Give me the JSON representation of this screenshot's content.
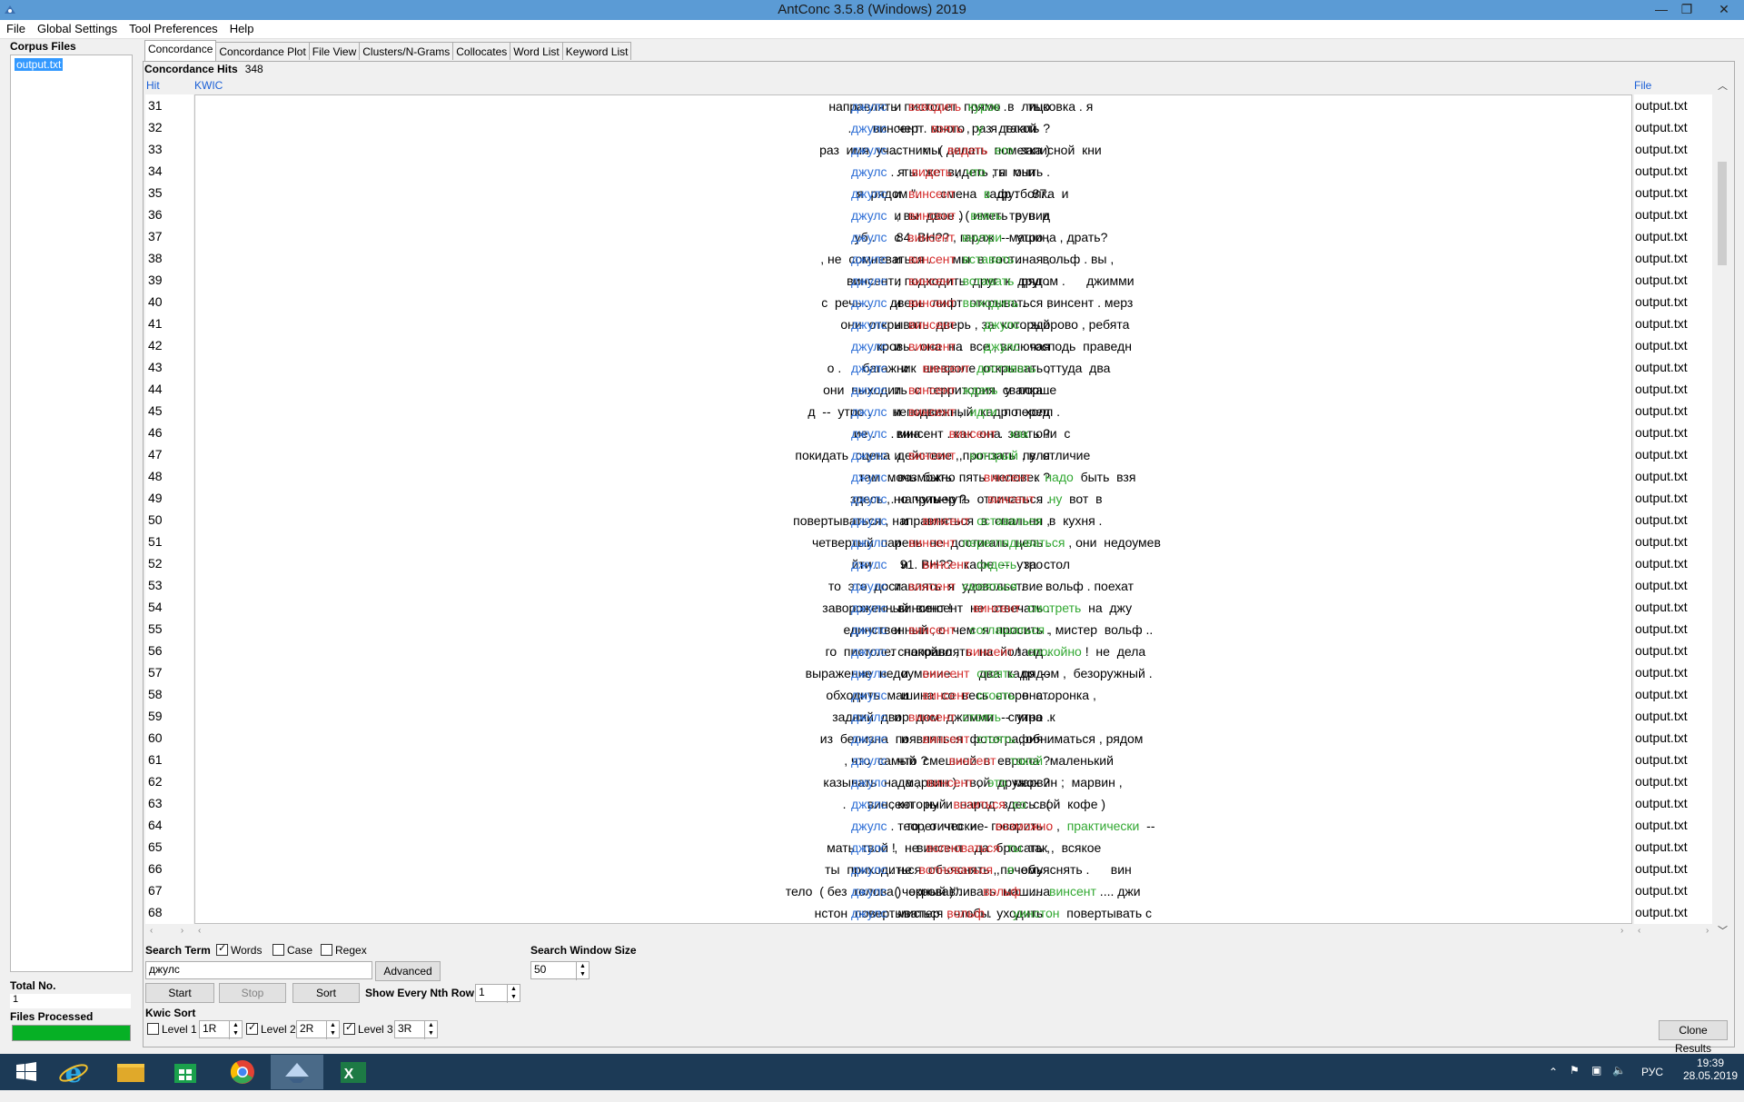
{
  "window": {
    "title": "AntConc 3.5.8 (Windows) 2019"
  },
  "menu": [
    "File",
    "Global Settings",
    "Tool Preferences",
    "Help"
  ],
  "corpus": {
    "title": "Corpus Files",
    "files": [
      "output.txt"
    ],
    "total_label": "Total No.",
    "total_value": "1",
    "processed_label": "Files Processed",
    "processed_fraction": 1.0
  },
  "tabs": [
    "Concordance",
    "Concordance Plot",
    "File View",
    "Clusters/N-Grams",
    "Collocates",
    "Word List",
    "Keyword List"
  ],
  "concordance": {
    "hits_label": "Concordance Hits",
    "hits_value": "348",
    "col_hit": "Hit",
    "col_kwic": "KWIC",
    "col_file": "File",
    "rows": [
      {
        "n": "31",
        "left": "направлять  пистолет  прямо  в  лицо",
        "kw": "джулс",
        "right": [
          [
            "  и  ",
            ""
          ],
          [
            "взводить",
            "r"
          ],
          [
            "  курок",
            "g"
          ],
          [
            " .      тыковка . я",
            ""
          ]
        ]
      },
      {
        "n": "32",
        "left": ".      винсент . много  раз  делать ?",
        "kw": "джулс",
        "right": [
          [
            " . черт  ",
            ""
          ],
          [
            "взять",
            "r"
          ],
          [
            " ,  ",
            ""
          ],
          [
            "у",
            "g"
          ],
          [
            "  я  такой",
            ""
          ]
        ]
      },
      {
        "n": "33",
        "left": "раз  имя  участник . ( делать  пометка )",
        "kw": "джулс",
        "right": [
          [
            " ...      мы  ",
            ""
          ],
          [
            "видеть",
            "r"
          ],
          [
            "  его",
            "g"
          ],
          [
            "  записной  кни",
            ""
          ]
        ]
      },
      {
        "n": "34",
        "left": ". ты  же  видеть , я  мыть .",
        "kw": "джулс",
        "right": [
          [
            " . я  ",
            ""
          ],
          [
            "видеть",
            "r"
          ],
          [
            " ,  ",
            ""
          ],
          [
            "что",
            "g"
          ],
          [
            "  ты  они",
            ""
          ]
        ]
      },
      {
        "n": "35",
        "left": "я  рядом \".      смена  кадр :    87.",
        "kw": "джулс",
        "right": [
          [
            "  и  ",
            ""
          ],
          [
            "винсент",
            "r"
          ],
          [
            " .      ",
            ""
          ],
          [
            "в",
            "g"
          ],
          [
            "  футболка  и",
            ""
          ]
        ]
      },
      {
        "n": "36",
        "left": ", вы  двое . ( иметь  в  вид",
        "kw": "джулс",
        "right": [
          [
            "  и  ",
            ""
          ],
          [
            "винсент",
            "r"
          ],
          [
            " )  ",
            ""
          ],
          [
            "взять",
            "g"
          ],
          [
            "  труп  и",
            ""
          ]
        ]
      },
      {
        "n": "37",
        "left": "уб .      84. ВН?? , гараж  --  утро ,",
        "kw": "джулс",
        "right": [
          [
            "  с  ",
            ""
          ],
          [
            "винсент",
            "r"
          ],
          [
            "  внутри",
            "g"
          ],
          [
            "  машина , драть?",
            ""
          ]
        ]
      },
      {
        "n": "38",
        "left": ", не  сомневаться .      мы  в  гостиная ,",
        "kw": "джулс",
        "right": [
          [
            "  и  ",
            ""
          ],
          [
            "винсент",
            "r"
          ],
          [
            "  вставать",
            "g"
          ],
          [
            " .      вольф . вы ,",
            ""
          ]
        ]
      },
      {
        "n": "39",
        "left": "винсент , подходить  друг  к  друг .",
        "kw": "джулс",
        "right": [
          [
            "  и  ",
            ""
          ],
          [
            "винсент",
            "r"
          ],
          [
            "  вставать",
            "g"
          ],
          [
            "  рядом .      джимми",
            ""
          ]
        ]
      },
      {
        "n": "40",
        "left": "с  речь .      дверь  лифт  открываться ,",
        "kw": "джулс",
        "right": [
          [
            "  и  ",
            ""
          ],
          [
            "винсент",
            "r"
          ],
          [
            "  выходить",
            "g"
          ],
          [
            " .      винсент . мерз",
            ""
          ]
        ]
      },
      {
        "n": "41",
        "left": "они  открывать  дверь , за  который",
        "kw": "джулс",
        "right": [
          [
            "  и  ",
            ""
          ],
          [
            "винсент",
            "r"
          ],
          [
            " .      ",
            ""
          ],
          [
            "джулс",
            "g"
          ],
          [
            " . здорово , ребята",
            ""
          ]
        ]
      },
      {
        "n": "42",
        "left": "кровь . она  на  все , включая",
        "kw": "джулс",
        "right": [
          [
            "  и  ",
            ""
          ],
          [
            "винсент",
            "r"
          ],
          [
            " .      ",
            ""
          ],
          [
            "джулс",
            "g"
          ],
          [
            " . господь  праведн",
            ""
          ]
        ]
      },
      {
        "n": "43",
        "left": "о .      багажник  шевроле  открывать ,",
        "kw": "джулс",
        "right": [
          [
            "    и    ",
            ""
          ],
          [
            "винсент",
            "r"
          ],
          [
            "  доставать",
            "g"
          ],
          [
            "  оттуда  два",
            ""
          ]
        ]
      },
      {
        "n": "44",
        "left": "они  выходить  с  территория  свалка .",
        "kw": "джулс",
        "right": [
          [
            "  и  ",
            ""
          ],
          [
            "винсент",
            "r"
          ],
          [
            "  ждать",
            "g"
          ],
          [
            "  у  порше",
            ""
          ]
        ]
      },
      {
        "n": "45",
        "left": "д  --  утро .      неподвижный  кадр  перед",
        "kw": "джулс",
        "right": [
          [
            "  и  ",
            ""
          ],
          [
            "винсент",
            "r"
          ],
          [
            " ,  ",
            ""
          ],
          [
            "идти",
            "g"
          ],
          [
            "  по  холл .",
            ""
          ]
        ]
      },
      {
        "n": "46",
        "left": "ие .      винсент . как  она  звать ?",
        "kw": "джулс",
        "right": [
          [
            " . миа .      ",
            ""
          ],
          [
            "винсент",
            "r"
          ],
          [
            " .  ",
            ""
          ],
          [
            "как",
            "g"
          ],
          [
            "  они  с",
            ""
          ]
        ]
      },
      {
        "n": "47",
        "left": "покидать  сцена  действие , пронзать  пуля",
        "kw": "джулс",
        "right": [
          [
            "  и  ",
            ""
          ],
          [
            "винсент",
            "r"
          ],
          [
            " ,  ",
            ""
          ],
          [
            "который",
            "g"
          ],
          [
            " , в  отличие",
            ""
          ]
        ]
      },
      {
        "n": "48",
        "left": "там  мочь  быть  пять  человек ?",
        "kw": "джулс",
        "right": [
          [
            " . возможно .      ",
            ""
          ],
          [
            "винсент",
            "r"
          ],
          [
            " .  ",
            ""
          ],
          [
            "надо",
            "g"
          ],
          [
            "  быть  взя",
            ""
          ]
        ]
      },
      {
        "n": "49",
        "left": "здесь , но  чуть-чуть  отличаться .",
        "kw": "джулс",
        "right": [
          [
            " . например ?      ",
            ""
          ],
          [
            "винсент",
            "r"
          ],
          [
            " .  ",
            ""
          ],
          [
            "ну",
            "g"
          ],
          [
            "  вот  в",
            ""
          ]
        ]
      },
      {
        "n": "50",
        "left": "повертываться , направляться  в  спальня ,",
        "kw": "джулс",
        "right": [
          [
            "    и    ",
            ""
          ],
          [
            "винсент",
            "r"
          ],
          [
            "  оставаться",
            "g"
          ],
          [
            "  в  кухня .",
            ""
          ]
        ]
      },
      {
        "n": "51",
        "left": "четвертый  парень  не  достигать  цель .",
        "kw": "джулс",
        "right": [
          [
            "  и  ",
            ""
          ],
          [
            "винсент",
            "r"
          ],
          [
            "  переглядываться",
            "g"
          ],
          [
            " , они  недоумев",
            ""
          ]
        ]
      },
      {
        "n": "52",
        "left": "йти .      91. ВН?? . кафе  --  утро .",
        "kw": "джулс",
        "right": [
          [
            "    и    ",
            ""
          ],
          [
            "винсент",
            "r"
          ],
          [
            "  сидеть",
            "g"
          ],
          [
            "  за  стол",
            ""
          ]
        ]
      },
      {
        "n": "53",
        "left": "то  это  доставлять  я  удовольствие .",
        "kw": "джулс",
        "right": [
          [
            "  и  ",
            ""
          ],
          [
            "винсент",
            "r"
          ],
          [
            "  смеяться",
            "g"
          ],
          [
            " .      вольф . поехат",
            ""
          ]
        ]
      },
      {
        "n": "54",
        "left": "завороженный  винсент  не  отвечать .",
        "kw": "джулс",
        "right": [
          [
            " . винсент !      ",
            ""
          ],
          [
            "винсент",
            "r"
          ],
          [
            "  смотреть",
            "g"
          ],
          [
            "  на  джу",
            ""
          ]
        ]
      },
      {
        "n": "55",
        "left": "единственный , о  чем  я  просить .",
        "kw": "джулс",
        "right": [
          [
            "  и  ",
            ""
          ],
          [
            "винсент",
            "r"
          ],
          [
            " .  ",
            ""
          ],
          [
            "соглашаться",
            "g"
          ],
          [
            " , мистер  вольф ..",
            ""
          ]
        ]
      },
      {
        "n": "56",
        "left": "го  пистолет  направлять  на  йоланд .",
        "kw": "джулс",
        "right": [
          [
            " . спокойно ,  ",
            ""
          ],
          [
            "винсент",
            "r"
          ],
          [
            " !  ",
            ""
          ],
          [
            "спокойно",
            "g"
          ],
          [
            " !  не  дела",
            ""
          ]
        ]
      },
      {
        "n": "57",
        "left": "выражение  недоумение .      два  кадр  --",
        "kw": "джулс",
        "right": [
          [
            "    и    ",
            ""
          ],
          [
            "винсент",
            "r"
          ],
          [
            "  стоять",
            "g"
          ],
          [
            "  рядом ,  безоружный .",
            ""
          ]
        ]
      },
      {
        "n": "58",
        "left": "обходить  машина  со  весь  сторона .",
        "kw": "джулс",
        "right": [
          [
            "    и    ",
            ""
          ],
          [
            "винсент",
            "r"
          ],
          [
            "  стоять",
            "g"
          ],
          [
            "  в  сторонка ,",
            ""
          ]
        ]
      },
      {
        "n": "59",
        "left": "задний  двор  дом  джимми  --  утро .",
        "kw": "джулс",
        "right": [
          [
            "  и  ",
            ""
          ],
          [
            "винсент",
            "r"
          ],
          [
            "  стоять",
            "g"
          ],
          [
            "  спина  к",
            ""
          ]
        ]
      },
      {
        "n": "60",
        "left": "из  белизна  появляться  фотография .",
        "kw": "джулс",
        "right": [
          [
            "    и    ",
            ""
          ],
          [
            "винсент",
            "r"
          ],
          [
            "  стоять",
            "g"
          ],
          [
            " , обниматься , рядом",
            ""
          ]
        ]
      },
      {
        "n": "61",
        "left": ", что  самый  смешной  в  европа ?",
        "kw": "джулс",
        "right": [
          [
            " . что ?      ",
            ""
          ],
          [
            "винсент",
            "r"
          ],
          [
            " .  ",
            ""
          ],
          [
            "такой",
            "g"
          ],
          [
            "  маленький",
            ""
          ]
        ]
      },
      {
        "n": "62",
        "left": "казывать  на  марвин ). твой  дружок ?",
        "kw": "джулс",
        "right": [
          [
            " . да ,  ",
            ""
          ],
          [
            "винсент",
            "r"
          ],
          [
            " ,  ",
            ""
          ],
          [
            "это",
            "g"
          ],
          [
            "  марвин ;  марвин ,",
            ""
          ]
        ]
      },
      {
        "n": "63",
        "left": ".      винсент . ну  и  народ  здесь . (",
        "kw": "джулс",
        "right": [
          [
            " , который  ",
            ""
          ],
          [
            "возиться",
            "r"
          ],
          [
            "  со",
            "g"
          ],
          [
            "  свой  кофе )",
            ""
          ]
        ]
      },
      {
        "n": "64",
        "left": "то , о  что  не  говорить .",
        "kw": "джулс",
        "right": [
          [
            " . теоретически  -  ",
            ""
          ],
          [
            "возможно",
            "r"
          ],
          [
            " ,  ",
            ""
          ],
          [
            "практически",
            "g"
          ],
          [
            "  --",
            ""
          ]
        ]
      },
      {
        "n": "65",
        "left": "мать  твой !      винсент . да  бросать ,",
        "kw": "джулс",
        "right": [
          [
            "  ,  не  ",
            ""
          ],
          [
            "волноваться",
            "r"
          ],
          [
            "  ты",
            "g"
          ],
          [
            "  так ,  всякое",
            ""
          ]
        ]
      },
      {
        "n": "66",
        "left": "ты  приходиться  объяснять , почему .",
        "kw": "джулс",
        "right": [
          [
            " . не  ",
            ""
          ],
          [
            "волноваться",
            "r"
          ],
          [
            " ,  ",
            ""
          ],
          [
            "я",
            "g"
          ],
          [
            "  объяснять .      вин",
            ""
          ]
        ]
      },
      {
        "n": "67",
        "left": "тело  ( без  голова )  окровавливать  машина",
        "kw": "джулс",
        "right": [
          [
            "  ( черный )\".      ",
            ""
          ],
          [
            "вольф",
            "r"
          ],
          [
            " . ...  ",
            ""
          ],
          [
            "винсент",
            "g"
          ],
          [
            " .... джи",
            ""
          ]
        ]
      },
      {
        "n": "68",
        "left": "нстон  повертываться , чтобы  уходить .",
        "kw": "джулс",
        "right": [
          [
            " . мистер  ",
            ""
          ],
          [
            "вольф",
            "r"
          ],
          [
            " .      ",
            ""
          ],
          [
            "уинстон",
            "g"
          ],
          [
            "  повертывать с",
            ""
          ]
        ]
      }
    ],
    "file": "output.txt"
  },
  "search": {
    "term_label": "Search Term",
    "words_label": "Words",
    "words_checked": true,
    "case_label": "Case",
    "case_checked": false,
    "regex_label": "Regex",
    "regex_checked": false,
    "term_value": "джулс",
    "advanced_label": "Advanced",
    "start_label": "Start",
    "stop_label": "Stop",
    "sort_label": "Sort",
    "nth_label": "Show Every Nth Row",
    "nth_value": "1",
    "window_label": "Search Window Size",
    "window_value": "50"
  },
  "kwic_sort": {
    "title": "Kwic Sort",
    "level1_label": "Level 1",
    "level1_value": "1R",
    "level1_checked": false,
    "level2_label": "Level 2",
    "level2_value": "2R",
    "level2_checked": true,
    "level3_label": "Level 3",
    "level3_value": "3R",
    "level3_checked": true
  },
  "clone_label": "Clone Results",
  "taskbar": {
    "apps": [
      "windows-start",
      "internet-explorer",
      "file-explorer",
      "store",
      "chrome",
      "antconc",
      "excel"
    ],
    "lang": "РУС",
    "time": "19:39",
    "date": "28.05.2019"
  }
}
